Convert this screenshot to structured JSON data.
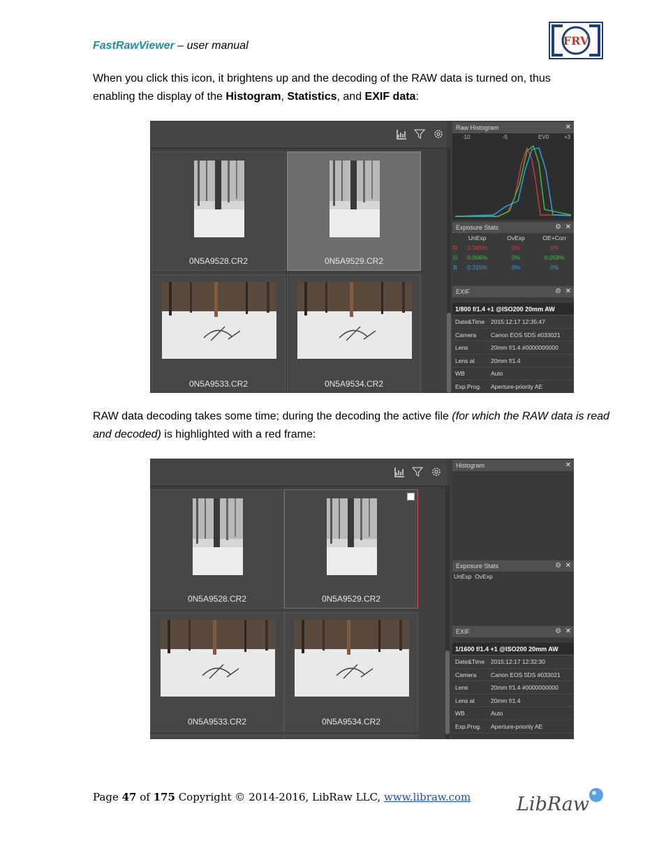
{
  "header": {
    "app_name": "FastRawViewer",
    "subtitle": " – user manual",
    "logo_text": "FRV"
  },
  "paragraph1": {
    "line1": "When you click this icon, it brightens up and the decoding of the RAW data is turned on, thus",
    "line2_pre": "enabling the display of the ",
    "b1": "Histogram",
    "sep1": ", ",
    "b2": "Statistics",
    "sep2": ", and ",
    "b3": "EXIF data",
    "end": ":"
  },
  "paragraph2": {
    "pre": "RAW data decoding takes some time; during the decoding the active file ",
    "italic": "(for which the RAW data is read and decoded)",
    "post": " is highlighted with a red frame:"
  },
  "screenshot1": {
    "files": [
      "0N5A9528.CR2",
      "0N5A9529.CR2",
      "0N5A9533.CR2",
      "0N5A9534.CR2"
    ],
    "histogram": {
      "title": "Raw Histogram",
      "scale": [
        "-10",
        "-5",
        "EV0",
        "+3"
      ]
    },
    "stats": {
      "title": "Exposure Stats",
      "columns": [
        "UnExp",
        "OvExp",
        "OE+Corr"
      ],
      "rows": [
        {
          "ch": "R",
          "color": "#d83a3a",
          "values": [
            "0.045%",
            "0%",
            "0%"
          ]
        },
        {
          "ch": "G",
          "color": "#3ec13e",
          "values": [
            "0.006%",
            "0%",
            "0.058%"
          ]
        },
        {
          "ch": "B",
          "color": "#2f9ee8",
          "values": [
            "0.315%",
            "0%",
            "0%"
          ]
        }
      ]
    },
    "exif": {
      "title": "EXIF",
      "summary": "1/800 f/1.4 +1 @ISO200 20mm AW",
      "rows": [
        {
          "k": "Date&Time",
          "v": "2015:12:17 12:35:47"
        },
        {
          "k": "Camera",
          "v": "Canon EOS 5DS #033021"
        },
        {
          "k": "Lens",
          "v": "20mm f/1.4 #0000000000"
        },
        {
          "k": "Lens at",
          "v": "20mm f/1.4"
        },
        {
          "k": "WB",
          "v": "Auto"
        },
        {
          "k": "Exp.Prog.",
          "v": "Aperture-priority AE"
        }
      ]
    }
  },
  "screenshot2": {
    "files": [
      "0N5A9528.CR2",
      "0N5A9529.CR2",
      "0N5A9533.CR2",
      "0N5A9534.CR2"
    ],
    "histogram": {
      "title": "Histogram"
    },
    "stats": {
      "title": "Exposure Stats",
      "columns": [
        "UnExp",
        "OvExp"
      ]
    },
    "exif": {
      "title": "EXIF",
      "summary": "1/1600 f/1.4 +1 @ISO200 20mm AW",
      "rows": [
        {
          "k": "Date&Time",
          "v": "2015:12:17 12:32:30"
        },
        {
          "k": "Camera",
          "v": "Canon EOS 5DS #033021"
        },
        {
          "k": "Lens",
          "v": "20mm f/1.4 #0000000000"
        },
        {
          "k": "Lens at",
          "v": "20mm f/1.4"
        },
        {
          "k": "WB",
          "v": "Auto"
        },
        {
          "k": "Exp.Prog.",
          "v": "Aperture-priority AE"
        }
      ]
    }
  },
  "icons": {
    "histogram": "histogram-icon",
    "filter": "filter-icon",
    "settings": "gear-icon",
    "close": "close-icon"
  },
  "footer": {
    "page_pre": "Page ",
    "page": "47",
    "of": " of ",
    "total": "175",
    "copyright": " Copyright © 2014-2016, LibRaw LLC, ",
    "link": "www.libraw.com",
    "logo_text": "LibRaw"
  }
}
